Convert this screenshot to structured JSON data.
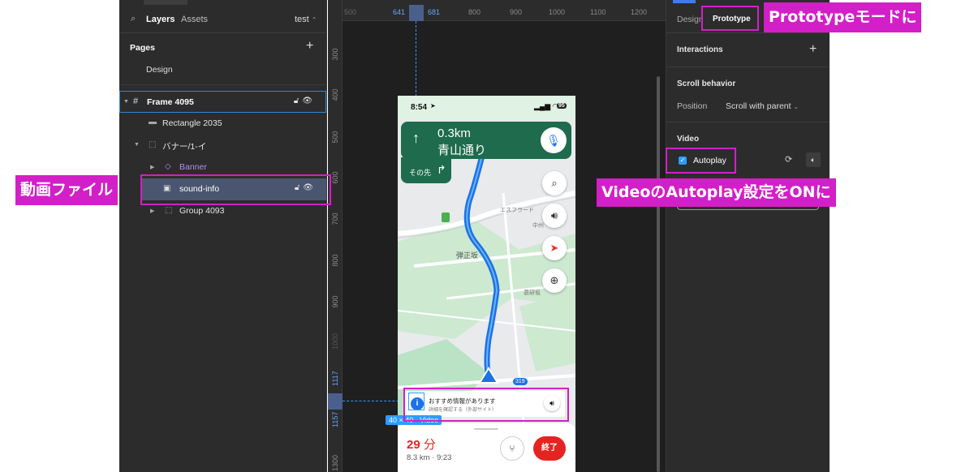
{
  "left_panel": {
    "tab_layers": "Layers",
    "tab_assets": "Assets",
    "page_name": "test",
    "pages_header": "Pages",
    "page_design": "Design",
    "layers": [
      {
        "name": "Frame 4095",
        "kind": "frame"
      },
      {
        "name": "Rectangle 2035",
        "kind": "rect"
      },
      {
        "name": "バナー/1-イ",
        "kind": "group"
      },
      {
        "name": "Banner",
        "kind": "component"
      },
      {
        "name": "sound-info",
        "kind": "video"
      },
      {
        "name": "Group 4093",
        "kind": "group"
      }
    ]
  },
  "rulers": {
    "top": [
      "500",
      "641",
      "681",
      "800",
      "900",
      "1000",
      "1100",
      "1200"
    ],
    "left": [
      "300",
      "400",
      "500",
      "600",
      "700",
      "800",
      "900",
      "1000",
      "1117",
      "1157",
      "1300"
    ]
  },
  "phone": {
    "time": "8:54",
    "battery": "95",
    "distance": "0.3km",
    "street": "青山通り",
    "then": "その先",
    "map_labels": [
      "弾正坂",
      "エスフラード",
      "中州",
      "蓑研坂",
      "319"
    ],
    "banner_title": "おすすめ情報があります",
    "banner_sub": "詳細を確認する（外部サイト）",
    "duration_num": "29",
    "duration_unit": "分",
    "trip_info": "8.3 km · 9:23",
    "end_button": "終了"
  },
  "selection_label": "40 × 40 · Video",
  "right_panel": {
    "tab_design": "Design",
    "tab_prototype": "Prototype",
    "interactions": "Interactions",
    "scroll_behavior": "Scroll behavior",
    "position_label": "Position",
    "position_value": "Scroll with parent",
    "video_header": "Video",
    "autoplay_label": "Autoplay"
  },
  "annotations": {
    "prototype_mode": "Prototypeモードに",
    "video_file": "動画ファイル",
    "autoplay_on": "VideoのAutoplay設定をONに"
  },
  "colors": {
    "accent": "#d31fc8",
    "selection": "#2d9cff",
    "nav_green": "#1e6b4d",
    "route_blue": "#1a73e8",
    "end_red": "#e52421"
  }
}
